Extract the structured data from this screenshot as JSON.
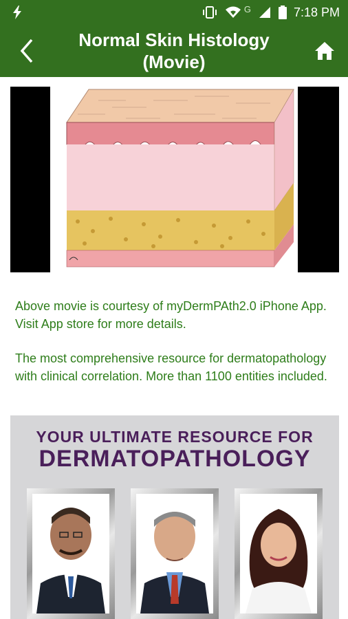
{
  "status_bar": {
    "time": "7:18 PM",
    "network_letter": "G",
    "icons": [
      "flash-icon",
      "vibrate-icon",
      "wifi-icon",
      "signal-icon",
      "battery-icon"
    ]
  },
  "app_bar": {
    "title": "Normal Skin Histology (Movie)",
    "back_icon": "chevron-left-icon",
    "home_icon": "home-icon",
    "color": "#33701f"
  },
  "content": {
    "credit_text": "Above movie is courtesy of myDermPAth2.0 iPhone App. Visit App store for more details.",
    "description": "The most comprehensive resource for dermatopathology with clinical correlation. More than 1100 entities included.",
    "text_color": "#2e7d1a"
  },
  "banner": {
    "line1": "YOUR ULTIMATE RESOURCE FOR",
    "line2": "DERMATOPATHOLOGY",
    "text_color": "#4a1f5a"
  }
}
